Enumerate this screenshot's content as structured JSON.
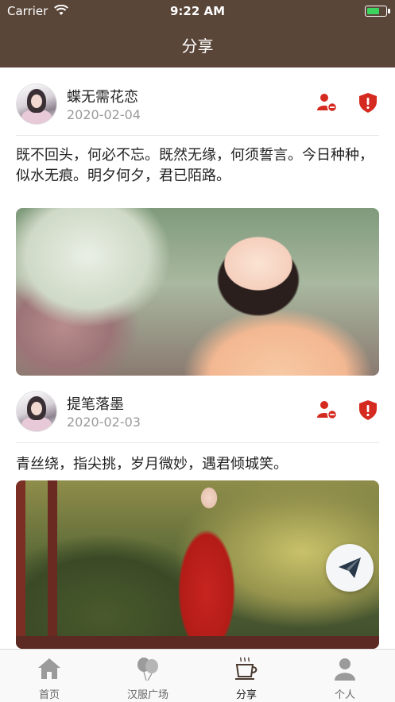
{
  "status_bar": {
    "carrier": "Carrier",
    "time": "9:22 AM",
    "battery_level": 0.75,
    "charging": true
  },
  "nav": {
    "title": "分享"
  },
  "posts": [
    {
      "username": "蝶无需花恋",
      "date": "2020-02-04",
      "text": "既不回头，何必不忘。既然无缘，何须誓言。今日种种，似水无痕。明夕何夕，君已陌路。"
    },
    {
      "username": "提笔落墨",
      "date": "2020-02-03",
      "text": "青丝绕，指尖挑，岁月微妙，遇君倾城笑。"
    }
  ],
  "tabs": [
    {
      "label": "首页",
      "icon": "home-icon"
    },
    {
      "label": "汉服广场",
      "icon": "balloons-icon"
    },
    {
      "label": "分享",
      "icon": "coffee-cup-icon",
      "active": true
    },
    {
      "label": "个人",
      "icon": "person-icon"
    }
  ],
  "colors": {
    "nav_bg": "#5a4639",
    "accent_red": "#d42a20",
    "tab_icon": "#9b9b9b",
    "tab_icon_active": "#4a3a30"
  }
}
